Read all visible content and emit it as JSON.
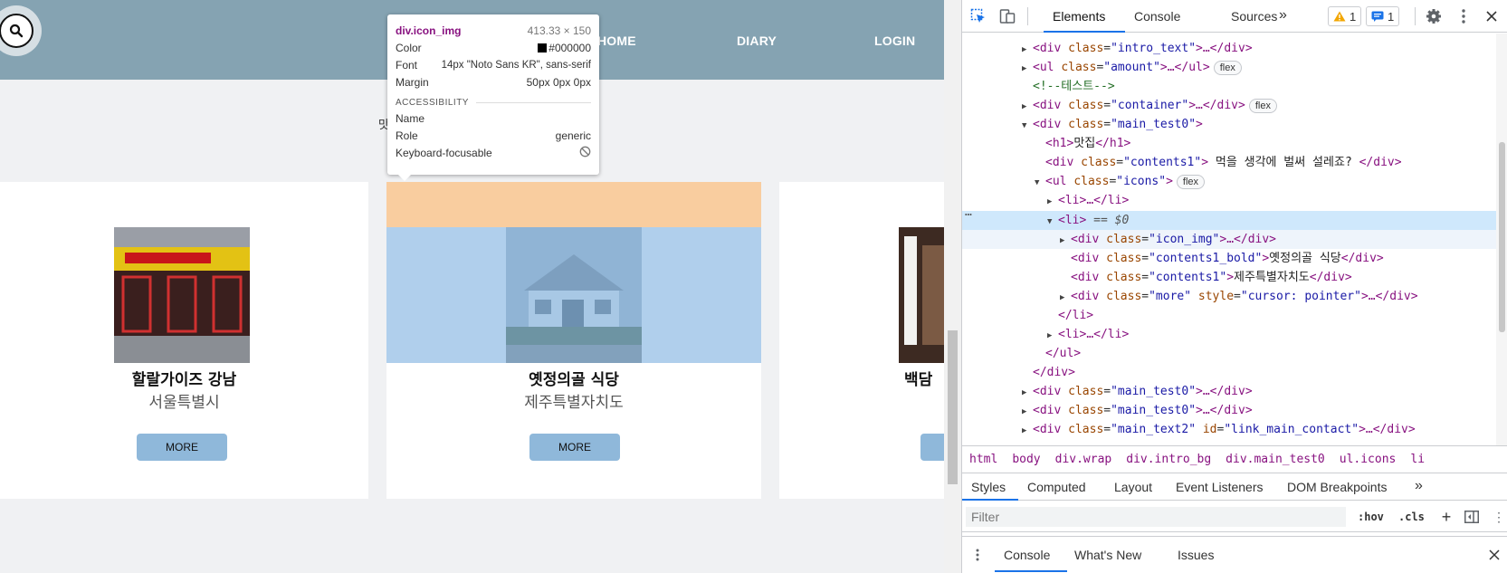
{
  "site": {
    "nav": {
      "home": "HOME",
      "diary": "DIARY",
      "login": "LOGIN"
    },
    "partial_heading_glyph": "맛",
    "cards": [
      {
        "title": "할랄가이즈 강남",
        "subtitle": "서울특별시",
        "more": "MORE"
      },
      {
        "title": "옛정의골 식당",
        "subtitle": "제주특별자치도",
        "more": "MORE"
      },
      {
        "title": "백담 ",
        "subtitle": "",
        "more": ""
      }
    ]
  },
  "tooltip": {
    "selector": "div.icon_img",
    "size": "413.33 × 150",
    "color_label": "Color",
    "color_value": "#000000",
    "font_label": "Font",
    "font_value": "14px \"Noto Sans KR\", sans-serif",
    "margin_label": "Margin",
    "margin_value": "50px 0px 0px",
    "section": "ACCESSIBILITY",
    "name_label": "Name",
    "name_value": "",
    "role_label": "Role",
    "role_value": "generic",
    "kf_label": "Keyboard-focusable"
  },
  "devtools": {
    "tabs": [
      "Elements",
      "Console",
      "Sources"
    ],
    "more_tabs": "»",
    "warnings": "1",
    "messages": "1",
    "tree": {
      "l0": {
        "open": "<div",
        "attr": "class",
        "val": "\"intro_text\"",
        "rest": ">…</div>"
      },
      "l1": {
        "open": "<ul",
        "attr": "class",
        "val": "\"amount\"",
        "rest": ">…</ul>",
        "pill": "flex"
      },
      "l2": {
        "comment": "<!--테스트-->"
      },
      "l3": {
        "open": "<div",
        "attr": "class",
        "val": "\"container\"",
        "rest": ">…</div>",
        "pill": "flex"
      },
      "l4": {
        "open": "<div",
        "attr": "class",
        "val": "\"main_test0\"",
        "rest": ">"
      },
      "l5": {
        "open": "<h1>",
        "text": "맛집",
        "close": "</h1>"
      },
      "l6": {
        "open": "<div",
        "attr": "class",
        "val": "\"contents1\"",
        "mid": ">",
        "text": " 먹을 생각에 벌써 설레죠? ",
        "close": "</div>"
      },
      "l7": {
        "open": "<ul",
        "attr": "class",
        "val": "\"icons\"",
        "rest": ">",
        "pill": "flex"
      },
      "l8": {
        "open": "<li>",
        "rest": "…</li>"
      },
      "l9": {
        "open": "<li>",
        "eq": " == $0"
      },
      "l10": {
        "open": "<div",
        "attr": "class",
        "val": "\"icon_img\"",
        "rest": ">…</div>"
      },
      "l11": {
        "open": "<div",
        "attr": "class",
        "val": "\"contents1_bold\"",
        "mid": ">",
        "text": "옛정의골 식당",
        "close": "</div>"
      },
      "l12": {
        "open": "<div",
        "attr": "class",
        "val": "\"contents1\"",
        "mid": ">",
        "text": "제주특별자치도",
        "close": "</div>"
      },
      "l13": {
        "open": "<div",
        "attr": "class",
        "val": "\"more\"",
        "attr2": "style",
        "val2": "\"cursor: pointer\"",
        "rest": ">…</div>"
      },
      "l14": {
        "close": "</li>"
      },
      "l15": {
        "open": "<li>",
        "rest": "…</li>"
      },
      "l16": {
        "close": "</ul>"
      },
      "l17": {
        "close": "</div>"
      },
      "l18": {
        "open": "<div",
        "attr": "class",
        "val": "\"main_test0\"",
        "rest": ">…</div>"
      },
      "l19": {
        "open": "<div",
        "attr": "class",
        "val": "\"main_test0\"",
        "rest": ">…</div>"
      },
      "l20": {
        "open": "<div",
        "attr": "class",
        "val": "\"main_text2\"",
        "attr2": "id",
        "val2": "\"link_main_contact\"",
        "rest": ">…</div>"
      }
    },
    "breadcrumbs": [
      "html",
      "body",
      "div.wrap",
      "div.intro_bg",
      "div.main_test0",
      "ul.icons",
      "li"
    ],
    "style_tabs": [
      "Styles",
      "Computed",
      "Layout",
      "Event Listeners",
      "DOM Breakpoints",
      "»"
    ],
    "filter_placeholder": "Filter",
    "hov": ":hov",
    "cls": ".cls",
    "drawer_tabs": [
      "Console",
      "What's New",
      "Issues"
    ]
  },
  "colors": {
    "nav_bg": "#85a3b2",
    "more_bg": "#8fb8da",
    "highlight_margin": "#f6b26b",
    "highlight_content": "#6fa8dc",
    "devtools_accent": "#1a73e8"
  }
}
